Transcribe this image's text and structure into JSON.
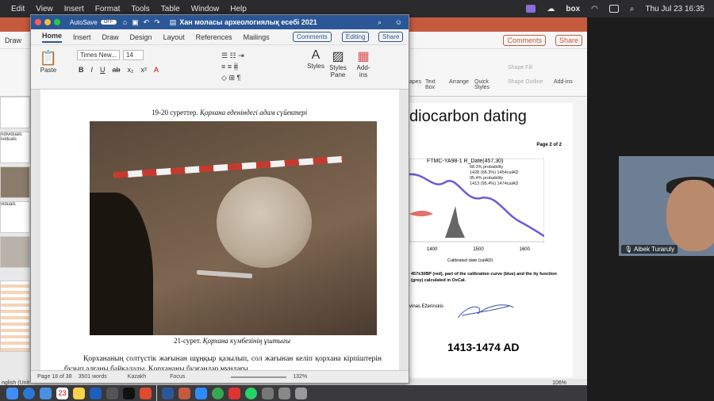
{
  "menubar": {
    "items": [
      "Edit",
      "View",
      "Insert",
      "Format",
      "Tools",
      "Table",
      "Window",
      "Help"
    ],
    "box_label": "box",
    "clock": "Thu Jul 23  16:35"
  },
  "ppt": {
    "tabs": [
      "Draw",
      "apes",
      "Text Box",
      "Arrange",
      "Quick Styles",
      "Shape Fill",
      "Shape Outline",
      "Add-ins"
    ],
    "comments_label": "Comments",
    "share_label": "Share",
    "slide_title": "diocarbon dating",
    "page_label": "Page 2 of 2",
    "chart_label": "FTMC-YA98-1 R_Date(457,30)",
    "prob_lines": [
      "68.3% probability",
      "1428 (68.3%) 1454calAD",
      "95.4% probability",
      "1413 (95.4%) 1474calAD"
    ],
    "axis_ticks": [
      "1400",
      "1500",
      "1600"
    ],
    "axis_label": "Calibrated date (calAD)",
    "note": "457±30BP (red), part of the calibration curve (blue) and the ity function (grey) calculated in OxCal.",
    "author": "vinas Ežerinskis",
    "date_range": "1413-1474  AD",
    "sidebar_labels": [
      "ndividuals",
      "ividuals",
      "viduals"
    ],
    "status_left": "nglish (Unit",
    "zoom": "106%"
  },
  "word": {
    "autosave": "AutoSave",
    "autosave_state": "OFF",
    "title": "Хан моласы археологиялық есебі 2021",
    "tabs": [
      "Home",
      "Insert",
      "Draw",
      "Design",
      "Layout",
      "References",
      "Mailings"
    ],
    "comments_label": "Comments",
    "editing_label": "Editing",
    "share_label": "Share",
    "font_name": "Times New...",
    "font_size": "14",
    "paste_label": "Paste",
    "styles_label": "Styles",
    "styles_pane_label": "Styles Pane",
    "addins_label": "Add-ins",
    "caption1_num": "19-20 суреттер.",
    "caption1_text": "Қорхана еденіндегі адам сүйектері",
    "caption2_num": "21-сурет.",
    "caption2_text": "Қорхана күмбезінің ұштығы",
    "body": "Қорхананың солтүстік жағынан шұңқыр қазылып, сол жағынан келіп қорхана кірпіштерін бұзып алғаны байқалады. Қорхананы бұзғандар мұндағы",
    "status_page": "Page 18 of 38",
    "status_words": "3501 words",
    "status_lang": "Kazakh",
    "status_focus": "Focus",
    "status_zoom": "132%"
  },
  "video": {
    "name": "Aibek Turaruly"
  },
  "dock_date": "23"
}
